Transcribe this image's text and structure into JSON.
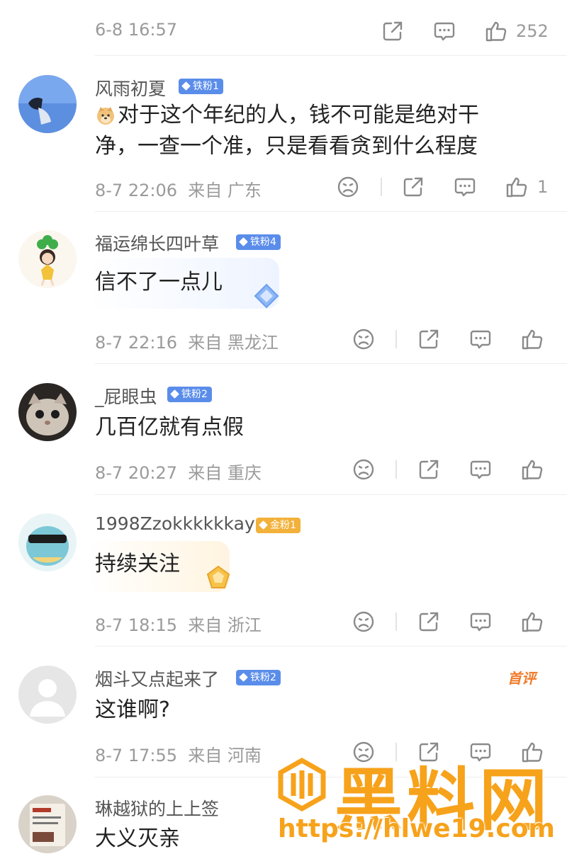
{
  "top_row": {
    "time": "6-8 16:57",
    "likes": "252"
  },
  "comments": [
    {
      "user": "风雨初夏",
      "badge": "铁粉1",
      "text_line1": "对于这个年纪的人，钱不可能是绝对干",
      "text_line2": "净，一查一个准，只是看看贪到什么程度",
      "time": "8-7 22:06",
      "location": "来自 广东",
      "likes": "1"
    },
    {
      "user": "福运绵长四叶草",
      "badge": "铁粉4",
      "text": "信不了一点儿",
      "time": "8-7 22:16",
      "location": "来自 黑龙江"
    },
    {
      "user": "_屁眼虫",
      "badge": "铁粉2",
      "text": "几百亿就有点假",
      "time": "8-7 20:27",
      "location": "来自 重庆"
    },
    {
      "user": "1998Zzokkkkkkay",
      "badge": "金粉1",
      "text": "持续关注",
      "time": "8-7 18:15",
      "location": "来自 浙江"
    },
    {
      "user": "烟斗又点起来了",
      "badge": "铁粉2",
      "first_tag": "首评",
      "text": "这谁啊?",
      "time": "8-7 17:55",
      "location": "来自 河南"
    },
    {
      "user": "琳越狱的上上签",
      "text": "大义灭亲"
    }
  ],
  "watermark": {
    "brand": "黑料网",
    "url": "https://hlwe19.com"
  },
  "colors": {
    "iron_badge": "#5a8dea",
    "gold_badge": "#f2b13a",
    "watermark": "#f7a21b",
    "first_tag": "#f07b2a"
  }
}
